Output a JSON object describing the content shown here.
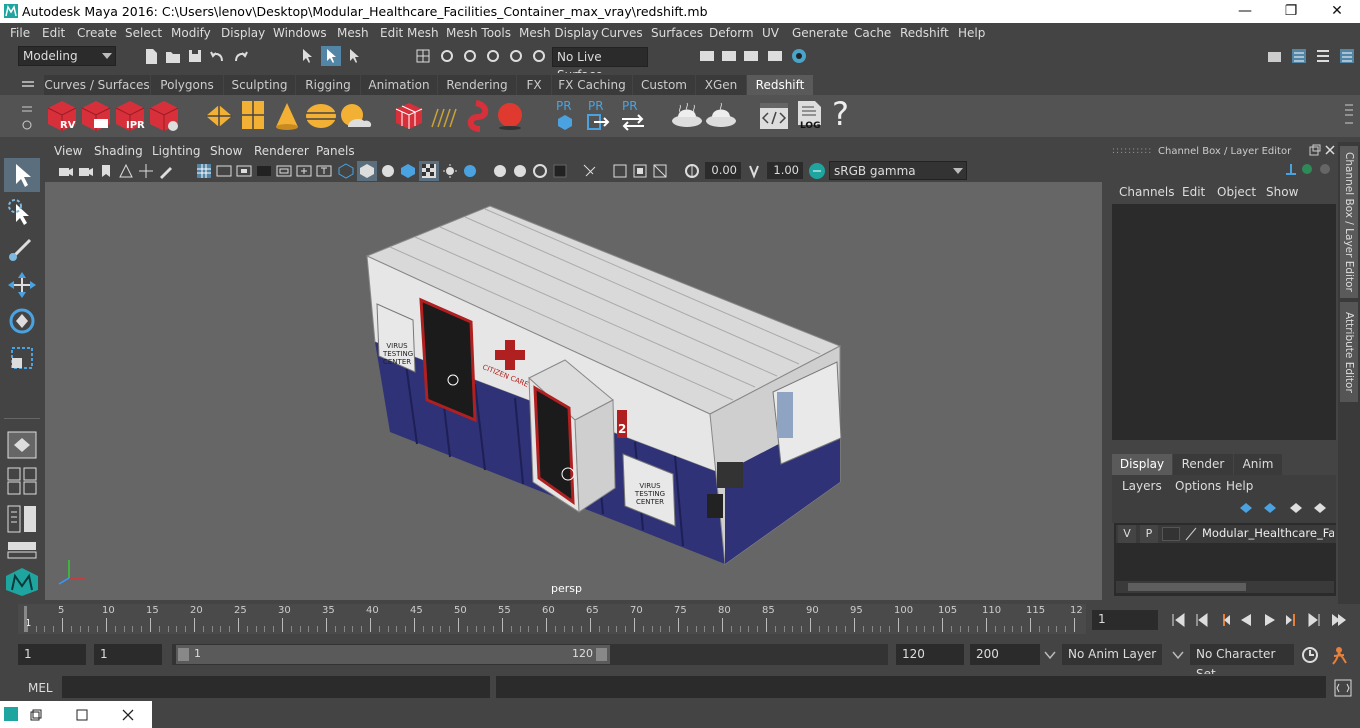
{
  "window": {
    "title": "Autodesk Maya 2016: C:\\Users\\lenov\\Desktop\\Modular_Healthcare_Facilities_Container_max_vray\\redshift.mb"
  },
  "menu": [
    "File",
    "Edit",
    "Create",
    "Select",
    "Modify",
    "Display",
    "Windows",
    "Mesh",
    "Edit Mesh",
    "Mesh Tools",
    "Mesh Display",
    "Curves",
    "Surfaces",
    "Deform",
    "UV",
    "Generate",
    "Cache",
    "Redshift",
    "Help"
  ],
  "status": {
    "mode": "Modeling",
    "live_surface": "No Live Surface"
  },
  "shelf_tabs": [
    "Curves / Surfaces",
    "Polygons",
    "Sculpting",
    "Rigging",
    "Animation",
    "Rendering",
    "FX",
    "FX Caching",
    "Custom",
    "XGen",
    "Redshift"
  ],
  "shelf": {
    "rv": "RV",
    "ipr": "IPR",
    "pr": "PR",
    "log": "LOG",
    "help": "?"
  },
  "panel_menu": [
    "View",
    "Shading",
    "Lighting",
    "Show",
    "Renderer",
    "Panels"
  ],
  "panel_tools": {
    "exposure": "0.00",
    "gamma": "1.00",
    "colorspace": "sRGB gamma"
  },
  "viewport": {
    "camera": "persp"
  },
  "model_labels": {
    "virus_testing_center": "VIRUS TESTING CENTER",
    "citizen_care": "CITIZEN CARE",
    "number": "2"
  },
  "channel_box": {
    "title": "Channel Box / Layer Editor",
    "menu": [
      "Channels",
      "Edit",
      "Object",
      "Show"
    ]
  },
  "layer_editor": {
    "tabs": [
      "Display",
      "Render",
      "Anim"
    ],
    "menu": [
      "Layers",
      "Options",
      "Help"
    ],
    "layer": {
      "v": "V",
      "p": "P",
      "name": "Modular_Healthcare_Faci"
    }
  },
  "side_tabs": {
    "channel_box": "Channel Box / Layer Editor",
    "attribute_editor": "Attribute Editor"
  },
  "timeline": {
    "ticks": [
      "5",
      "10",
      "15",
      "20",
      "25",
      "30",
      "35",
      "40",
      "45",
      "50",
      "55",
      "60",
      "65",
      "70",
      "75",
      "80",
      "85",
      "90",
      "95",
      "100",
      "105",
      "110",
      "115",
      "12"
    ],
    "start_label": "1",
    "current_frame": "1"
  },
  "range": {
    "start": "1",
    "start2": "1",
    "slider_start": "1",
    "slider_end": "120",
    "end": "120",
    "end2": "200",
    "anim_layer": "No Anim Layer",
    "char_set": "No Character Set"
  },
  "cmd": {
    "label": "MEL"
  },
  "colors": {
    "accent": "#5285a6",
    "viewport": "#666666",
    "panel": "#444444"
  }
}
